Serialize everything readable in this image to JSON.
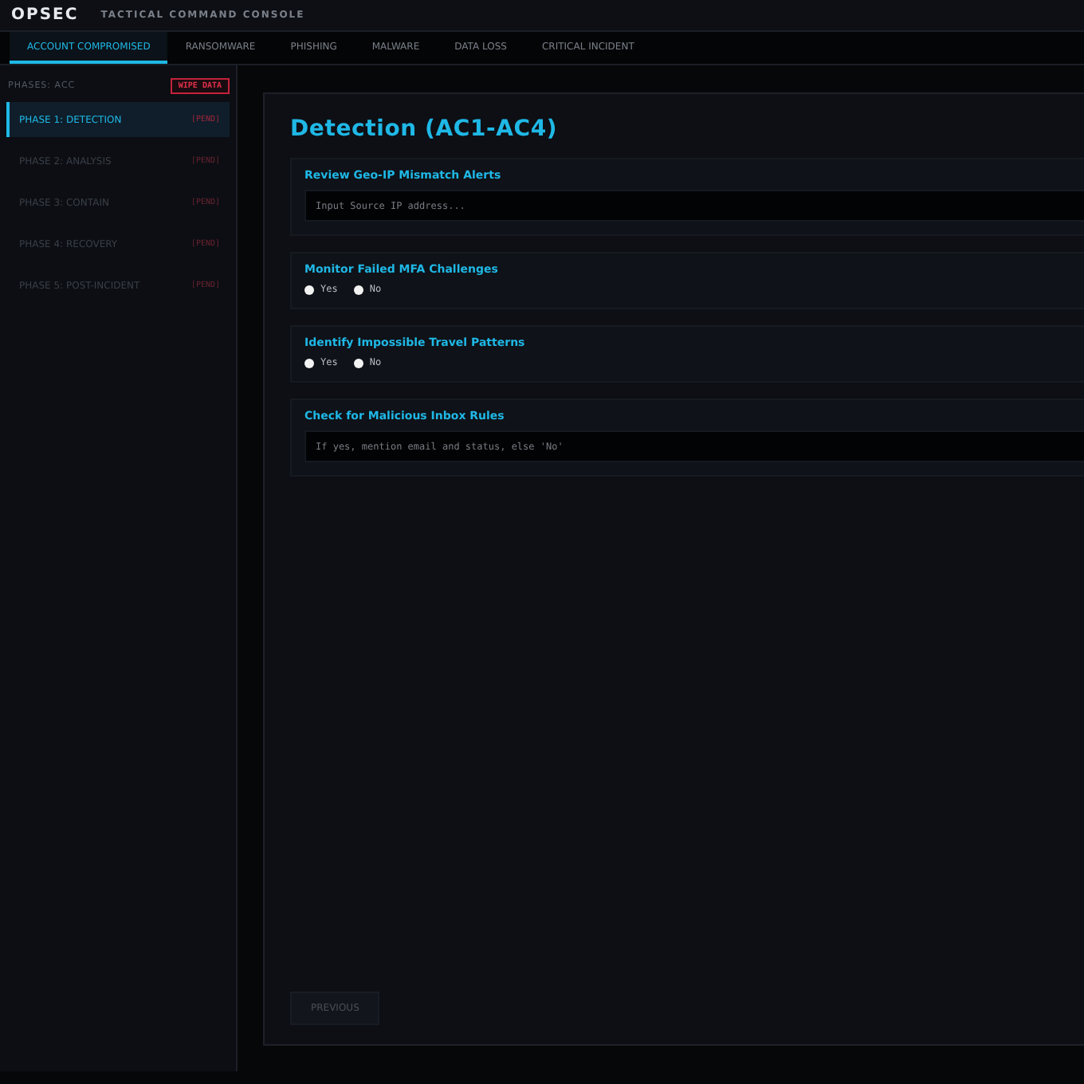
{
  "header": {
    "logo": "OPSEC",
    "subtitle": "TACTICAL COMMAND CONSOLE"
  },
  "tabs": [
    {
      "label": "ACCOUNT COMPROMISED",
      "selected": true
    },
    {
      "label": "RANSOMWARE",
      "selected": false
    },
    {
      "label": "PHISHING",
      "selected": false
    },
    {
      "label": "MALWARE",
      "selected": false
    },
    {
      "label": "DATA LOSS",
      "selected": false
    },
    {
      "label": "CRITICAL INCIDENT",
      "selected": false
    }
  ],
  "sidebar": {
    "heading": "PHASES: ACC",
    "wipe_button": "WIPE DATA",
    "items": [
      {
        "label": "PHASE 1: DETECTION",
        "status": "[PEND]",
        "selected": true
      },
      {
        "label": "PHASE 2: ANALYSIS",
        "status": "[PEND]",
        "selected": false
      },
      {
        "label": "PHASE 3: CONTAIN",
        "status": "[PEND]",
        "selected": false
      },
      {
        "label": "PHASE 4: RECOVERY",
        "status": "[PEND]",
        "selected": false
      },
      {
        "label": "PHASE 5: POST-INCIDENT",
        "status": "[PEND]",
        "selected": false
      }
    ]
  },
  "panel": {
    "title": "Detection (AC1-AC4)",
    "questions": [
      {
        "kind": "text",
        "label": "Review Geo-IP Mismatch Alerts",
        "placeholder": "Input Source IP address..."
      },
      {
        "kind": "radio",
        "label": "Monitor Failed MFA Challenges",
        "options": [
          {
            "label": "Yes",
            "selected": false
          },
          {
            "label": "No",
            "selected": false
          }
        ]
      },
      {
        "kind": "radio",
        "label": "Identify Impossible Travel Patterns",
        "options": [
          {
            "label": "Yes",
            "selected": false
          },
          {
            "label": "No",
            "selected": false
          }
        ]
      },
      {
        "kind": "text",
        "label": "Check for Malicious Inbox Rules",
        "placeholder": "If yes, mention email and status, else 'No'"
      }
    ],
    "previous_button": {
      "label": "PREVIOUS",
      "disabled": true
    }
  }
}
